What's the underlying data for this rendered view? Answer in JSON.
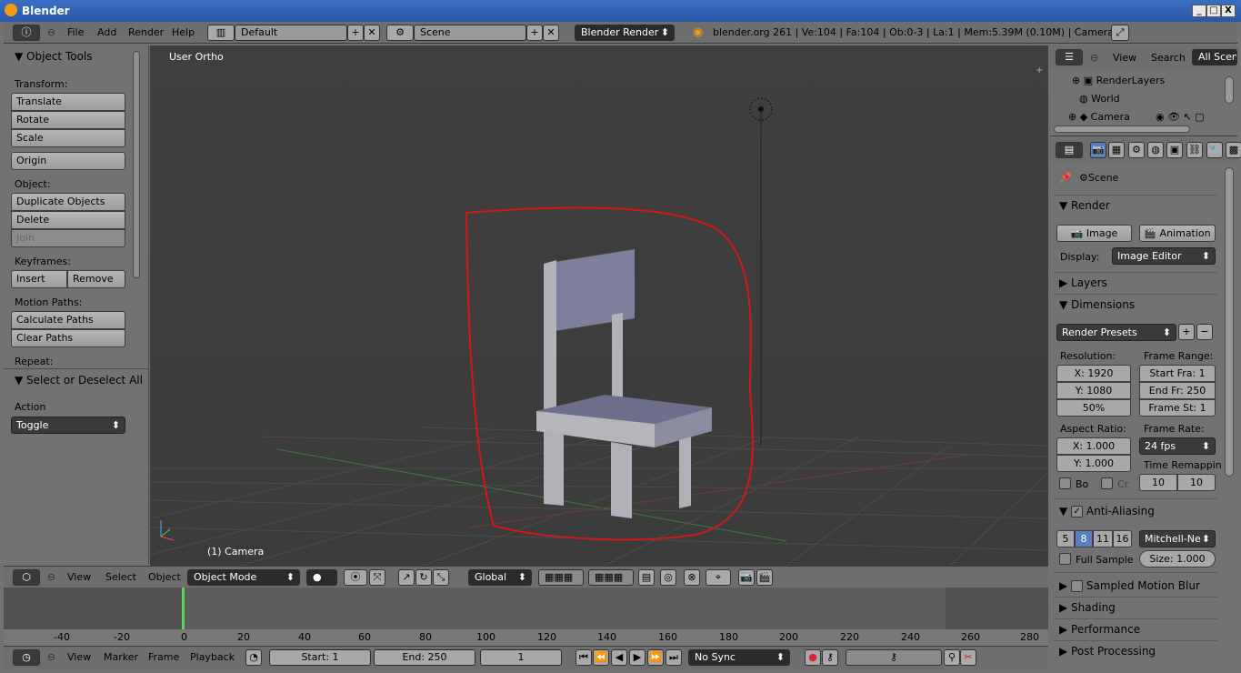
{
  "window": {
    "title": "Blender",
    "buttons": [
      "_",
      "□",
      "X"
    ]
  },
  "info_header": {
    "menus": [
      "File",
      "Add",
      "Render",
      "Help"
    ],
    "layout": "Default",
    "scene": "Scene",
    "engine": "Blender Render",
    "stats": "blender.org 261 | Ve:104 | Fa:104 | Ob:0-3 | La:1 | Mem:5.39M (0.10M) | Camera"
  },
  "tool_panel": {
    "title": "Object Tools",
    "transform_label": "Transform:",
    "translate": "Translate",
    "rotate": "Rotate",
    "scale": "Scale",
    "origin": "Origin",
    "object_label": "Object:",
    "duplicate": "Duplicate Objects",
    "delete": "Delete",
    "join": "Join",
    "keyframes_label": "Keyframes:",
    "insert": "Insert",
    "remove": "Remove",
    "motion_label": "Motion Paths:",
    "calc_paths": "Calculate Paths",
    "clear_paths": "Clear Paths",
    "repeat_label": "Repeat:",
    "op_title": "Select or Deselect All",
    "action_label": "Action",
    "action_value": "Toggle"
  },
  "viewport": {
    "view_name": "User Ortho",
    "object_info": "(1) Camera"
  },
  "view3d_header": {
    "menus": [
      "View",
      "Select",
      "Object"
    ],
    "mode": "Object Mode",
    "orientation": "Global"
  },
  "timeline": {
    "ruler": [
      "-40",
      "-20",
      "0",
      "20",
      "40",
      "60",
      "80",
      "100",
      "120",
      "140",
      "160",
      "180",
      "200",
      "220",
      "240",
      "260",
      "280"
    ],
    "current_frame_value": 0,
    "menus": [
      "View",
      "Marker",
      "Frame",
      "Playback"
    ],
    "start": "Start: 1",
    "end": "End: 250",
    "current": "1",
    "sync": "No Sync"
  },
  "outliner": {
    "menus": [
      "View",
      "Search"
    ],
    "filter": "All Scenes",
    "items": [
      "RenderLayers",
      "World",
      "Camera"
    ]
  },
  "properties": {
    "scene": "Scene",
    "render_title": "Render",
    "image_btn": "Image",
    "animation_btn": "Animation",
    "display_label": "Display:",
    "display_value": "Image Editor",
    "layers": "Layers",
    "dimensions": "Dimensions",
    "presets": "Render Presets",
    "resolution_label": "Resolution:",
    "res_x": "X: 1920",
    "res_y": "Y: 1080",
    "res_pct": "50%",
    "frame_range_label": "Frame Range:",
    "start_frame": "Start Fra: 1",
    "end_frame": "End Fr: 250",
    "frame_step": "Frame St: 1",
    "aspect_label": "Aspect Ratio:",
    "aspect_x": "X: 1.000",
    "aspect_y": "Y: 1.000",
    "frame_rate_label": "Frame Rate:",
    "frame_rate": "24 fps",
    "time_remap_label": "Time Remappin",
    "remap_old": "10",
    "remap_new": "10",
    "border_label": "Bo",
    "crop_label": "Cr",
    "aa_title": "Anti-Aliasing",
    "aa_samples": [
      "5",
      "8",
      "11",
      "16"
    ],
    "aa_filter": "Mitchell-Ne",
    "full_sample": "Full Sample",
    "aa_size": "Size: 1.000",
    "sampled_motion_blur": "Sampled Motion Blur",
    "shading": "Shading",
    "performance": "Performance",
    "post_processing": "Post Processing"
  }
}
